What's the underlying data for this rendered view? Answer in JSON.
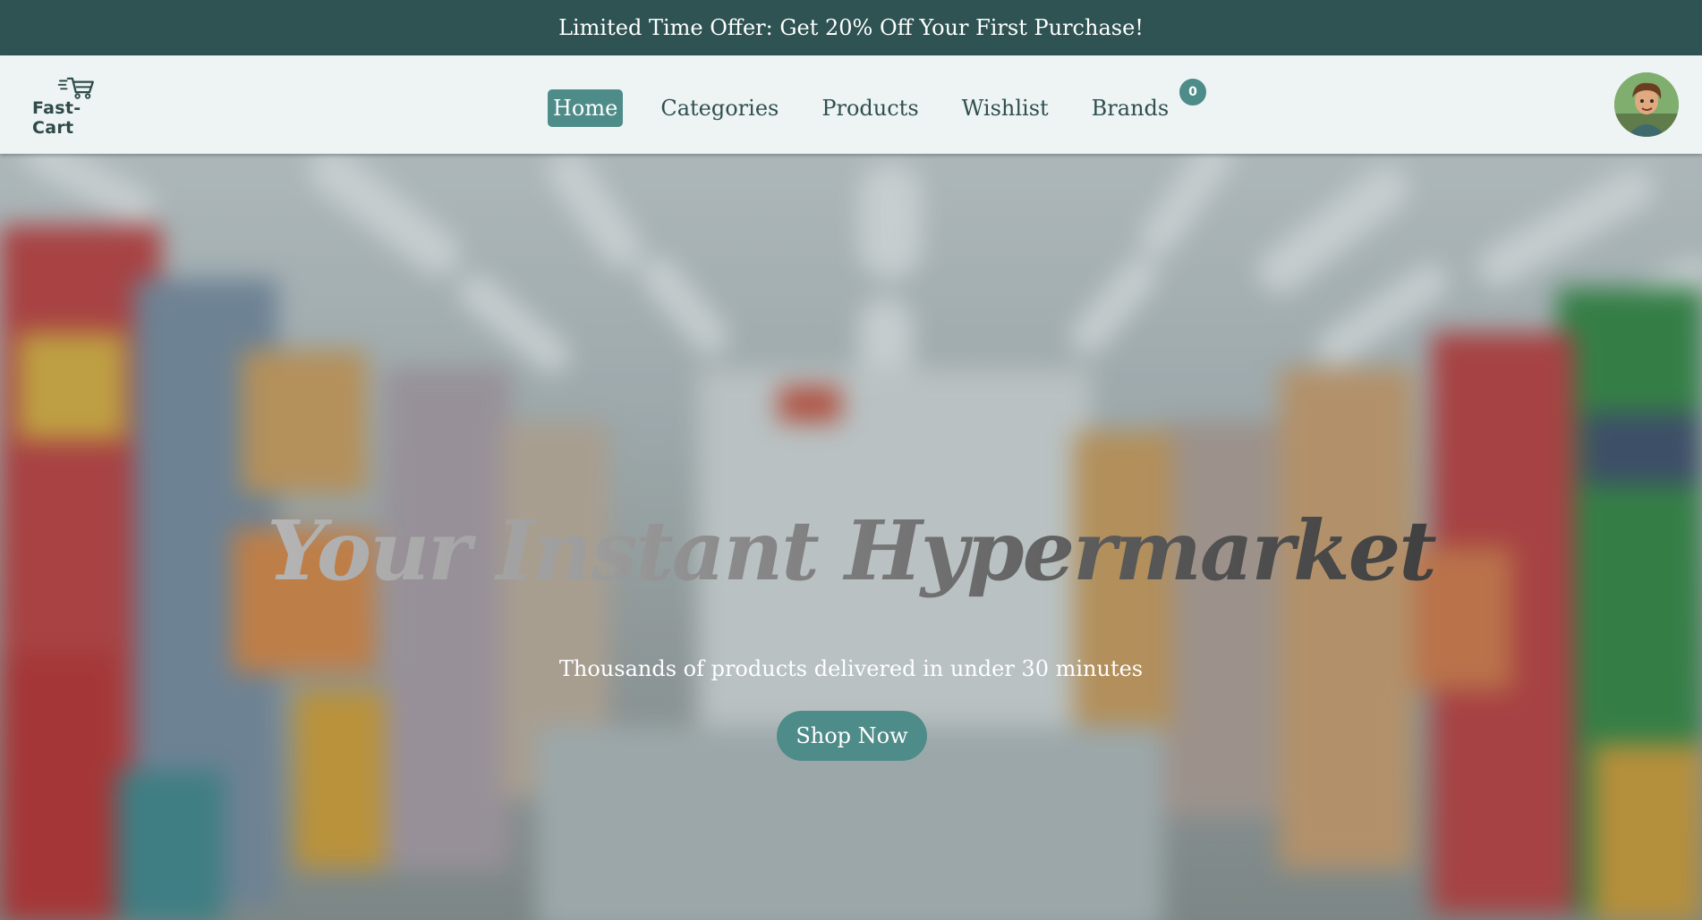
{
  "promo": {
    "text": "Limited Time Offer: Get 20% Off Your First Purchase!"
  },
  "header": {
    "logo_text": "Fast-Cart",
    "nav": [
      {
        "label": "Home",
        "active": true
      },
      {
        "label": "Categories",
        "active": false
      },
      {
        "label": "Products",
        "active": false
      },
      {
        "label": "Wishlist",
        "active": false
      },
      {
        "label": "Brands",
        "active": false
      }
    ],
    "cart_count": "0",
    "cart_icon": "shopping-cart-icon",
    "avatar_icon": "user-avatar"
  },
  "hero": {
    "title": "Your Instant Hypermarket",
    "subtitle": "Thousands of products delivered in under 30 minutes",
    "cta_label": "Shop Now"
  },
  "colors": {
    "promo_bg": "#2e5352",
    "accent": "#4e8c89",
    "nav_bg": "#eef4f4",
    "text_dark": "#2f4f4f"
  }
}
